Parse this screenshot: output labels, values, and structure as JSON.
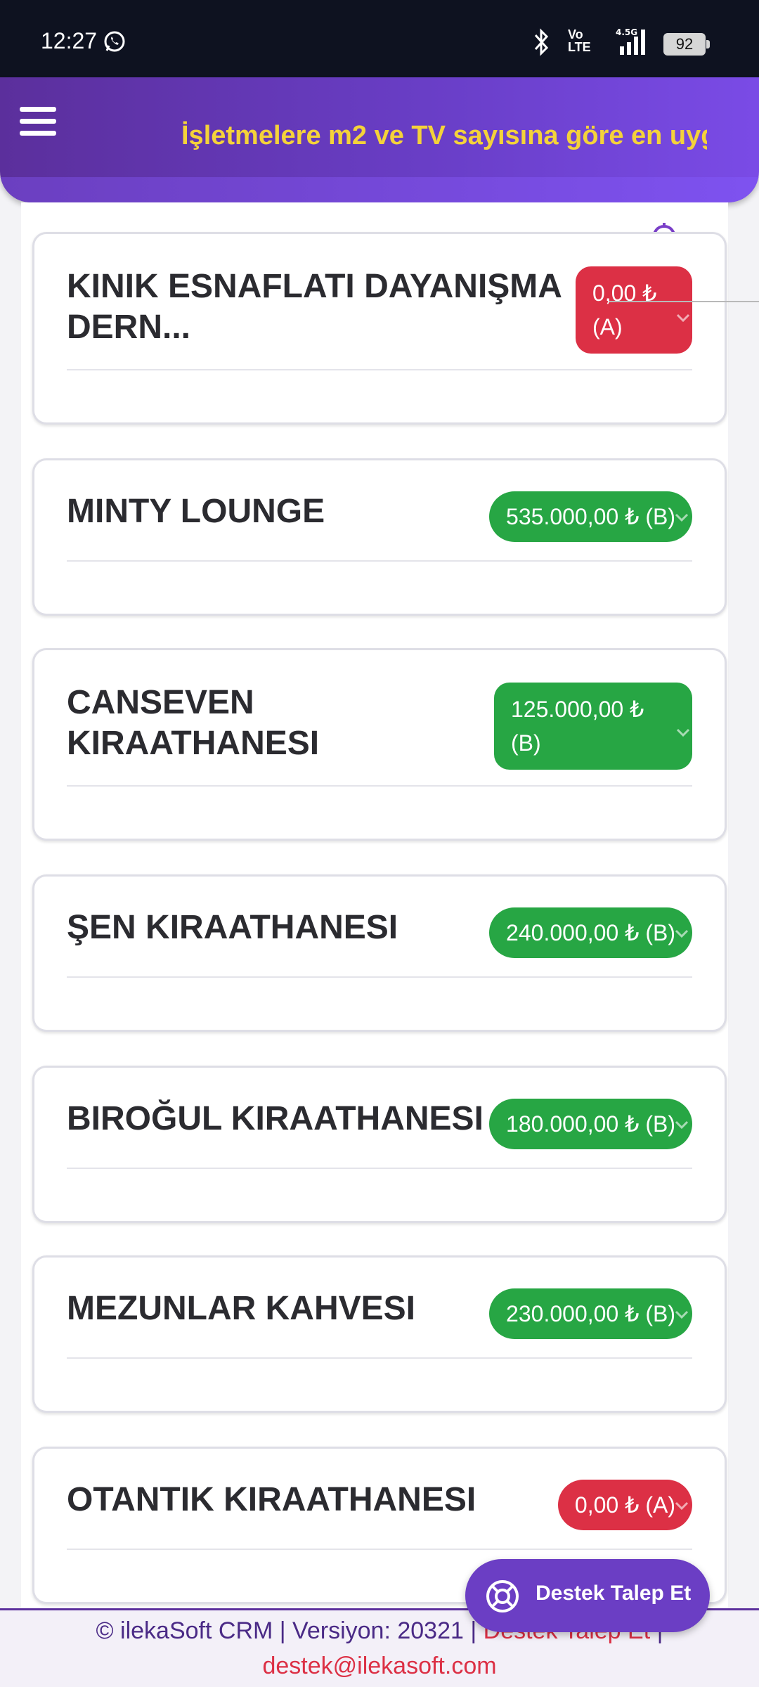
{
  "status_bar": {
    "time": "12:27",
    "volte": "Vo\nLTE",
    "network": "4.5G",
    "battery": "92",
    "icons": [
      "whatsapp-icon",
      "bluetooth-icon",
      "volte-icon",
      "signal-icon",
      "battery-icon"
    ]
  },
  "header": {
    "menu_icon": "hamburger-icon",
    "marquee_text": "İşletmelere m2 ve TV sayısına göre en uyg"
  },
  "cards": [
    {
      "name": "KINIK ESNAFLATI DAYANIŞMA DERN...",
      "badge": "0,00 ₺ (A)",
      "status": "red"
    },
    {
      "name": "MINTY LOUNGE",
      "badge": "535.000,00 ₺ (B)",
      "status": "green"
    },
    {
      "name": "CANSEVEN KIRAATHANESI",
      "badge": "125.000,00 ₺ (B)",
      "status": "green"
    },
    {
      "name": "ŞEN KIRAATHANESI",
      "badge": "240.000,00 ₺ (B)",
      "status": "green"
    },
    {
      "name": "BIROĞUL KIRAATHANESI",
      "badge": "180.000,00 ₺ (B)",
      "status": "green"
    },
    {
      "name": "MEZUNLAR KAHVESI",
      "badge": "230.000,00 ₺ (B)",
      "status": "green"
    },
    {
      "name": "OTANTIK KIRAATHANESI",
      "badge": "0,00 ₺ (A)",
      "status": "red"
    }
  ],
  "footer": {
    "prefix": "© ilekaSoft CRM | Versiyon: 20321 |",
    "link": "Destek Talep Et",
    "suffix": "|",
    "email": "destek@ilekasoft.com"
  },
  "fab": {
    "label": "Destek Talep Et",
    "icon": "lifebuoy-icon"
  },
  "colors": {
    "header_purple": "#6a3fc9",
    "marquee_yellow": "#f4d23a",
    "badge_green": "#27a644",
    "badge_red": "#dc3045"
  }
}
